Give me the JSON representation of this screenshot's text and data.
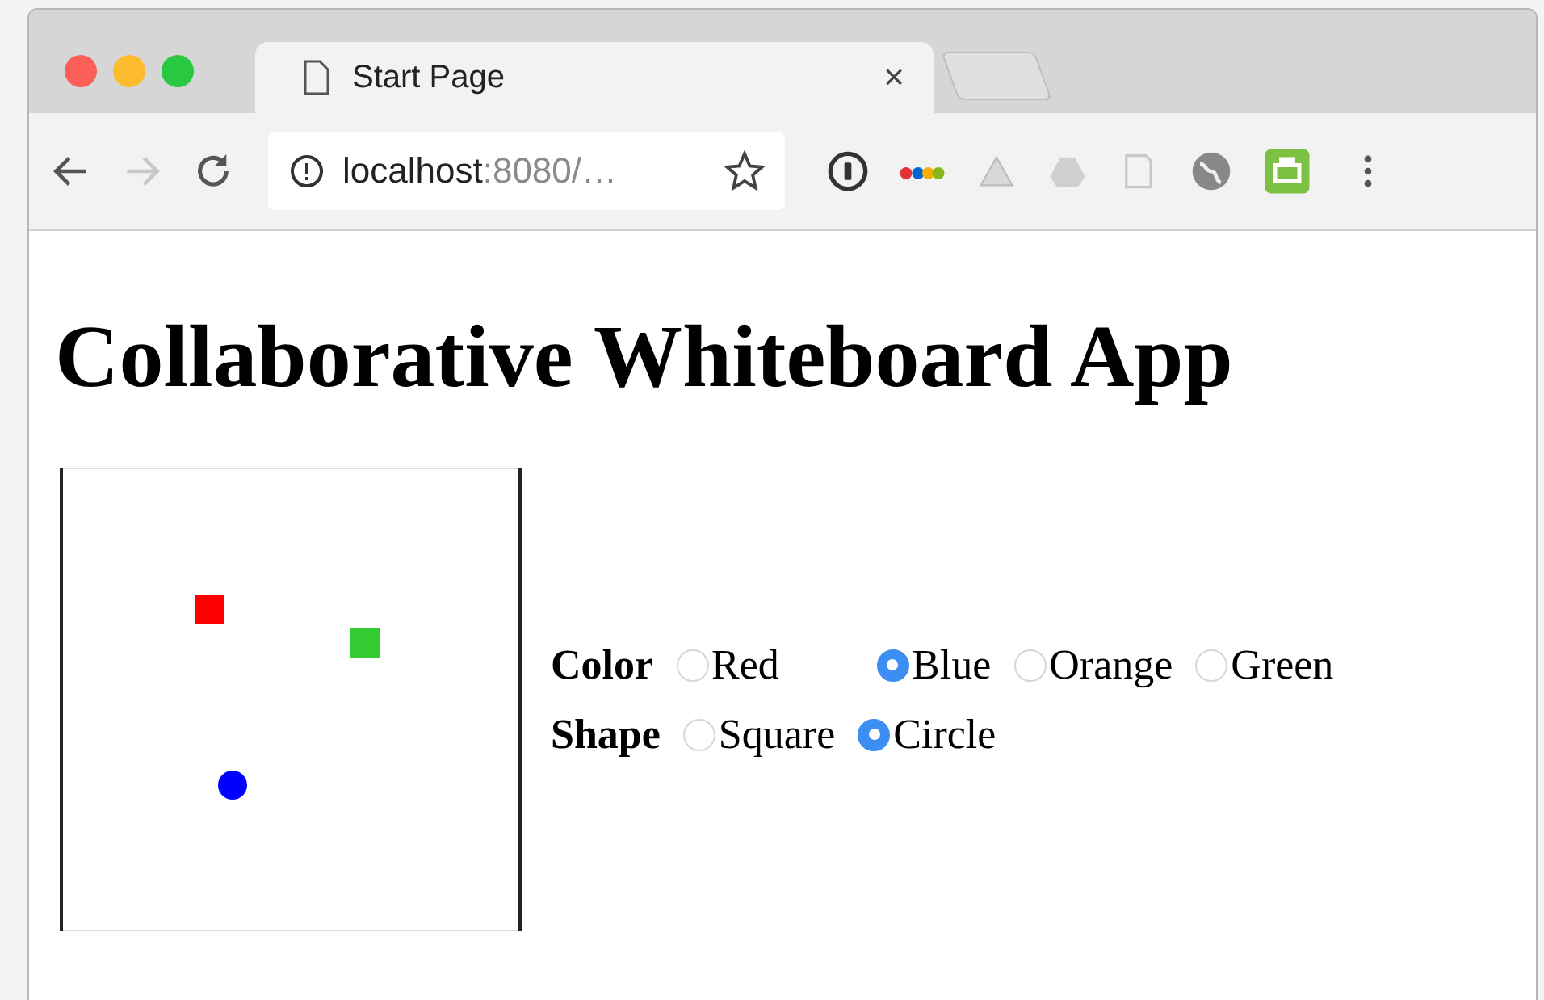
{
  "browser": {
    "tab": {
      "title": "Start Page",
      "close": "×"
    },
    "address": {
      "host": "localhost",
      "rest": ":8080/…"
    },
    "forward_disabled": true
  },
  "page": {
    "heading": "Collaborative Whiteboard App",
    "canvas": {
      "shapes": [
        {
          "kind": "square",
          "color": "#ff0000"
        },
        {
          "kind": "square",
          "color": "#33cc33"
        },
        {
          "kind": "circle",
          "color": "#0000ff"
        }
      ]
    },
    "groups": [
      {
        "label": "Color",
        "options": [
          {
            "label": "Red",
            "selected": false
          },
          {
            "label": "Blue",
            "selected": true
          },
          {
            "label": "Orange",
            "selected": false
          },
          {
            "label": "Green",
            "selected": false
          }
        ]
      },
      {
        "label": "Shape",
        "options": [
          {
            "label": "Square",
            "selected": false
          },
          {
            "label": "Circle",
            "selected": true
          }
        ]
      }
    ]
  }
}
